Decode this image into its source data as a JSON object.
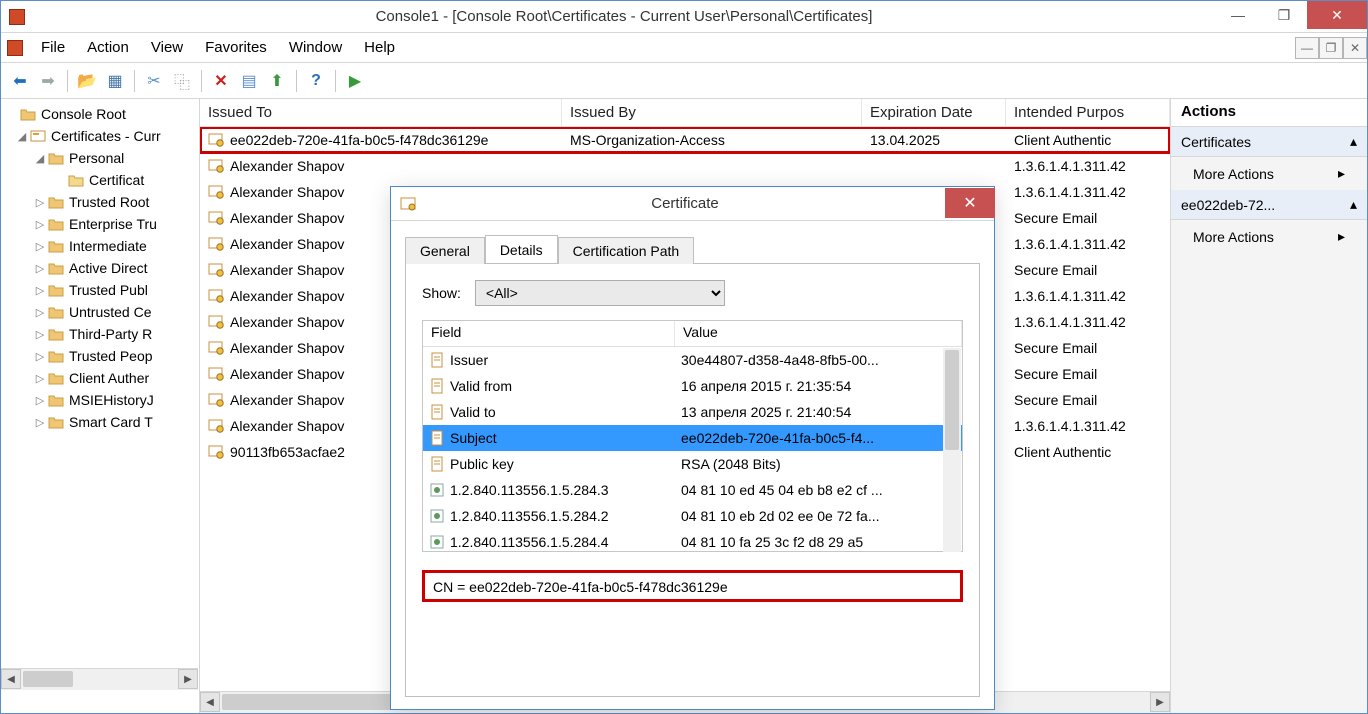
{
  "window": {
    "title": "Console1 - [Console Root\\Certificates - Current User\\Personal\\Certificates]"
  },
  "menubar": [
    "File",
    "Action",
    "View",
    "Favorites",
    "Window",
    "Help"
  ],
  "tree": {
    "root": "Console Root",
    "cert_user": "Certificates - Curr",
    "personal": "Personal",
    "certificates": "Certificat",
    "items": [
      "Trusted Root",
      "Enterprise Tru",
      "Intermediate",
      "Active Direct",
      "Trusted Publ",
      "Untrusted Ce",
      "Third-Party R",
      "Trusted Peop",
      "Client Auther",
      "MSIEHistoryJ",
      "Smart Card T"
    ]
  },
  "columns": {
    "issued_to": "Issued To",
    "issued_by": "Issued By",
    "expiration": "Expiration Date",
    "purpose": "Intended Purpos"
  },
  "rows": [
    {
      "to": "ee022deb-720e-41fa-b0c5-f478dc36129e",
      "by": "MS-Organization-Access",
      "exp": "13.04.2025",
      "purp": "Client Authentic",
      "hl": true
    },
    {
      "to": "Alexander Shapov",
      "by": "",
      "exp": "",
      "purp": "1.3.6.1.4.1.311.42"
    },
    {
      "to": "Alexander Shapov",
      "by": "",
      "exp": "",
      "purp": "1.3.6.1.4.1.311.42"
    },
    {
      "to": "Alexander Shapov",
      "by": "",
      "exp": "",
      "purp": "Secure Email"
    },
    {
      "to": "Alexander Shapov",
      "by": "",
      "exp": "",
      "purp": "1.3.6.1.4.1.311.42"
    },
    {
      "to": "Alexander Shapov",
      "by": "",
      "exp": "",
      "purp": "Secure Email"
    },
    {
      "to": "Alexander Shapov",
      "by": "",
      "exp": "",
      "purp": "1.3.6.1.4.1.311.42"
    },
    {
      "to": "Alexander Shapov",
      "by": "",
      "exp": "",
      "purp": "1.3.6.1.4.1.311.42"
    },
    {
      "to": "Alexander Shapov",
      "by": "",
      "exp": "",
      "purp": "Secure Email"
    },
    {
      "to": "Alexander Shapov",
      "by": "",
      "exp": "",
      "purp": "Secure Email"
    },
    {
      "to": "Alexander Shapov",
      "by": "",
      "exp": "",
      "purp": "Secure Email"
    },
    {
      "to": "Alexander Shapov",
      "by": "",
      "exp": "",
      "purp": "1.3.6.1.4.1.311.42"
    },
    {
      "to": "90113fb653acfae2",
      "by": "",
      "exp": "",
      "purp": "Client Authentic"
    }
  ],
  "actions": {
    "header": "Actions",
    "sec1": "Certificates",
    "more": "More Actions",
    "sec2": "ee022deb-72..."
  },
  "dialog": {
    "title": "Certificate",
    "tabs": {
      "general": "General",
      "details": "Details",
      "path": "Certification Path"
    },
    "show_label": "Show:",
    "show_value": "<All>",
    "field_hdr": "Field",
    "value_hdr": "Value",
    "fields": [
      {
        "f": "Issuer",
        "v": "30e44807-d358-4a48-8fb5-00...",
        "icon": "doc"
      },
      {
        "f": "Valid from",
        "v": "16 апреля 2015 г. 21:35:54",
        "icon": "doc"
      },
      {
        "f": "Valid to",
        "v": "13 апреля 2025 г. 21:40:54",
        "icon": "doc"
      },
      {
        "f": "Subject",
        "v": "ee022deb-720e-41fa-b0c5-f4...",
        "icon": "doc",
        "sel": true
      },
      {
        "f": "Public key",
        "v": "RSA (2048 Bits)",
        "icon": "doc"
      },
      {
        "f": "1.2.840.113556.1.5.284.3",
        "v": "04 81 10 ed 45 04 eb b8 e2 cf ...",
        "icon": "ext"
      },
      {
        "f": "1.2.840.113556.1.5.284.2",
        "v": "04 81 10 eb 2d 02 ee 0e 72 fa...",
        "icon": "ext"
      },
      {
        "f": "1.2.840.113556.1.5.284.4",
        "v": "04 81 10 fa 25 3c f2 d8 29 a5",
        "icon": "ext"
      }
    ],
    "detail": "CN = ee022deb-720e-41fa-b0c5-f478dc36129e"
  }
}
